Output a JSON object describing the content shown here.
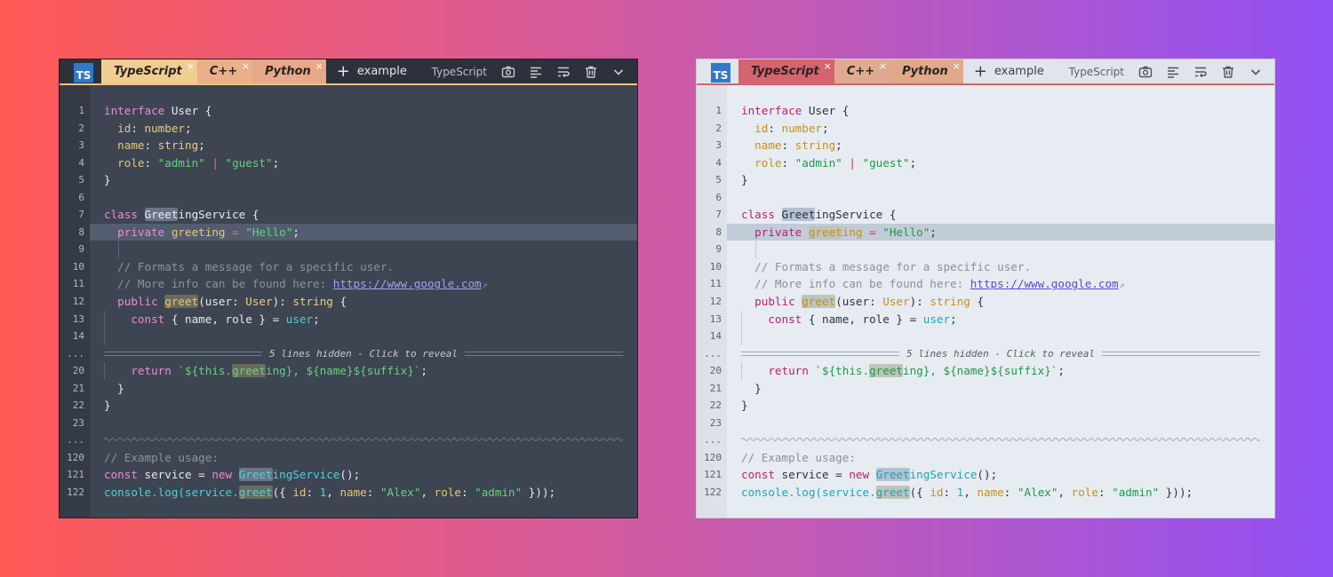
{
  "badge": "TS",
  "tabs": [
    {
      "label": "TypeScript",
      "close": "×"
    },
    {
      "label": "C++",
      "close": "×"
    },
    {
      "label": "Python",
      "close": "×"
    }
  ],
  "add_tab": "+",
  "file_label": "example",
  "language_label": "TypeScript",
  "fold_label": "5 lines hidden - Click to reveal",
  "gap_marker": "...",
  "icons": [
    "camera-icon",
    "align-left-icon",
    "wrap-icon",
    "trash-icon",
    "chevron-down-icon"
  ],
  "lines": {
    "l1": {
      "n": "1"
    },
    "l2": {
      "n": "2"
    },
    "l3": {
      "n": "3"
    },
    "l4": {
      "n": "4"
    },
    "l5": {
      "n": "5"
    },
    "l6": {
      "n": "6"
    },
    "l7": {
      "n": "7"
    },
    "l8": {
      "n": "8"
    },
    "l9": {
      "n": "9"
    },
    "l10": {
      "n": "10"
    },
    "l11": {
      "n": "11"
    },
    "l12": {
      "n": "12"
    },
    "l13": {
      "n": "13"
    },
    "l14": {
      "n": "14"
    },
    "l20": {
      "n": "20"
    },
    "l21": {
      "n": "21"
    },
    "l22": {
      "n": "22"
    },
    "l23": {
      "n": "23"
    },
    "l120": {
      "n": "120"
    },
    "l121": {
      "n": "121"
    },
    "l122": {
      "n": "122"
    }
  },
  "code": {
    "l1": {
      "a": "interface",
      "b": " User {"
    },
    "l2": {
      "a": "  id",
      "b": ": ",
      "c": "number",
      "d": ";"
    },
    "l3": {
      "a": "  name",
      "b": ": ",
      "c": "string",
      "d": ";"
    },
    "l4": {
      "a": "  role",
      "b": ": ",
      "c": "\"admin\"",
      "d": " | ",
      "e": "\"guest\"",
      "f": ";"
    },
    "l5": {
      "a": "}"
    },
    "l7": {
      "a": "class",
      "b": " ",
      "c": "Greet",
      "d": "ingService {"
    },
    "l8": {
      "a": "  private",
      "b": " ",
      "c": "greet",
      "d": "ing",
      "e": " = ",
      "f": "\"Hello\"",
      "g": ";"
    },
    "l10": {
      "a": "  // Formats a message for a specific user."
    },
    "l11": {
      "a": "  // More info can be found here: ",
      "b": "https://www.google.com",
      "c": "↗"
    },
    "l12": {
      "a": "  public",
      "b": " ",
      "c": "greet",
      "d": "(user: ",
      "e": "User",
      "f": "): ",
      "g": "string",
      "h": " {"
    },
    "l13": {
      "a": "    const",
      "b": " { name, role } = ",
      "c": "user",
      "d": ";"
    },
    "l20": {
      "a": "    return",
      "b": " `${this.",
      "c": "greet",
      "d": "ing}, ${name}${suffix}`",
      "e": ";"
    },
    "l21": {
      "a": "  }"
    },
    "l22": {
      "a": "}"
    },
    "l120": {
      "a": "// Example usage:"
    },
    "l121": {
      "a": "const",
      "b": " service = ",
      "c": "new",
      "d": " ",
      "e": "Greet",
      "f": "ingService",
      "g": "();"
    },
    "l122": {
      "a": "console",
      "b": ".log(service.",
      "c": "greet",
      "d": "({ ",
      "e": "id",
      "f": ": ",
      "g": "1",
      "h": ", ",
      "i": "name",
      "j": ": ",
      "k": "\"Alex\"",
      "l": ", ",
      "m": "role",
      "n": ": ",
      "o": "\"admin\"",
      "p": " }));"
    }
  },
  "colors": {
    "dark_bg": "#3d4452",
    "light_bg": "#e7ecf2",
    "dark_active_tab": "#f1cd91",
    "light_active_tab": "#d4646e",
    "ts_badge": "#3178c6"
  }
}
